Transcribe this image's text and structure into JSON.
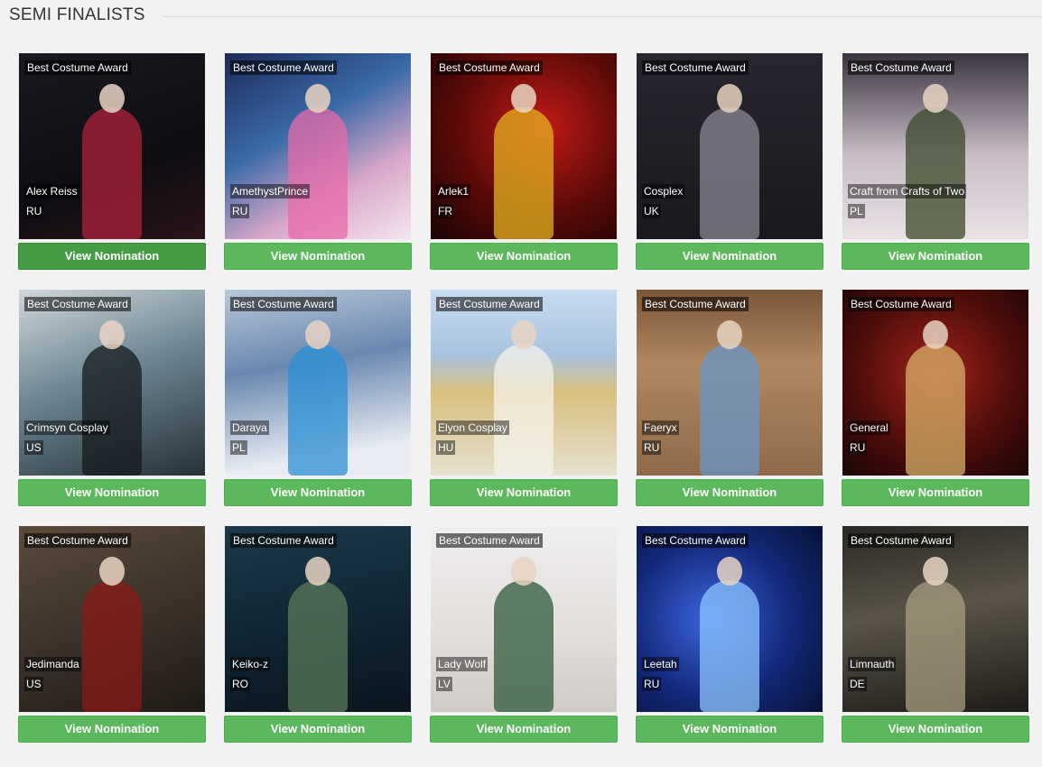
{
  "section": {
    "title": "SEMI FINALISTS"
  },
  "button_label": "View Nomination",
  "award_label": "Best Costume Award",
  "nominees": [
    {
      "name": "Alex Reiss",
      "country": "RU",
      "bg": "linear-gradient(160deg,#1a1a22 0%,#0d0d12 60%,#2a1418 100%)",
      "accent": "#b0213a"
    },
    {
      "name": "AmethystPrince",
      "country": "RU",
      "bg": "linear-gradient(150deg,#1c2a5a 0%,#3a6aa8 40%,#d9a7c9 70%,#f3e6ef 100%)",
      "accent": "#e86aa9"
    },
    {
      "name": "Arlek1",
      "country": "FR",
      "bg": "radial-gradient(circle at 60% 40%,#c21a14 0%,#5a0a08 55%,#1a0404 100%)",
      "accent": "#e3b21f"
    },
    {
      "name": "Cosplex",
      "country": "UK",
      "bg": "linear-gradient(180deg,#2a2630 0%,#1a181e 100%)",
      "accent": "#8a8694"
    },
    {
      "name": "Craft from Crafts of Two",
      "country": "PL",
      "bg": "linear-gradient(180deg,#3a3340 0%,#c9bcc6 55%,#e9e2e6 100%)",
      "accent": "#3c4a2a"
    },
    {
      "name": "Crimsyn Cosplay",
      "country": "US",
      "bg": "linear-gradient(160deg,#cfd8dc 0%,#6f8794 45%,#253138 100%)",
      "accent": "#141a1e"
    },
    {
      "name": "Daraya",
      "country": "PL",
      "bg": "linear-gradient(170deg,#b9c7d9 0%,#6a88b0 40%,#e9edf3 85%)",
      "accent": "#2b8fd6"
    },
    {
      "name": "Elyon Cosplay",
      "country": "HU",
      "bg": "linear-gradient(180deg,#c8dbef 0%,#a8c3e0 35%,#d8c07e 55%,#e6e0cf 100%)",
      "accent": "#f4f1ea"
    },
    {
      "name": "Faeryx",
      "country": "RU",
      "bg": "linear-gradient(180deg,#7a5638 0%,#b08760 40%,#8e6a49 100%)",
      "accent": "#6a95c8"
    },
    {
      "name": "General",
      "country": "RU",
      "bg": "radial-gradient(circle at 50% 45%,#a2221a 0%,#4a0c0a 60%,#1a0606 100%)",
      "accent": "#d7b067"
    },
    {
      "name": "Jedimanda",
      "country": "US",
      "bg": "linear-gradient(160deg,#5a4a3a 0%,#3a3028 55%,#1f1a16 100%)",
      "accent": "#8a1a18"
    },
    {
      "name": "Keiko-z",
      "country": "RO",
      "bg": "linear-gradient(170deg,#1a3a4a 0%,#0f2230 60%,#0a1620 100%)",
      "accent": "#5a7a5a"
    },
    {
      "name": "Lady Wolf",
      "country": "LV",
      "bg": "linear-gradient(180deg,#f0eeee 0%,#e1dedb 60%,#cfcac5 100%)",
      "accent": "#2e5a3a"
    },
    {
      "name": "Leetah",
      "country": "RU",
      "bg": "radial-gradient(circle at 40% 50%,#3a66e0 0%,#13287a 55%,#081236 100%)",
      "accent": "#8ec4ff"
    },
    {
      "name": "Limnauth",
      "country": "DE",
      "bg": "linear-gradient(170deg,#2a2824 0%,#5a5448 45%,#1e1c18 100%)",
      "accent": "#a89c80"
    }
  ]
}
